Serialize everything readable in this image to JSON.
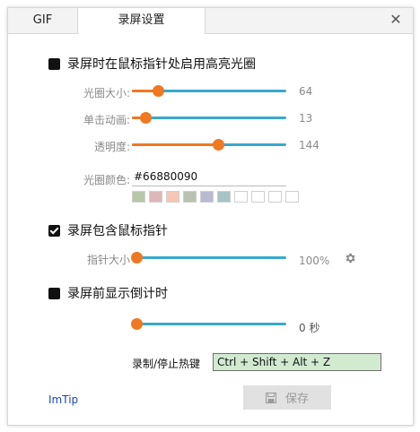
{
  "tabs": [
    {
      "label": "GIF"
    },
    {
      "label": "录屏设置"
    }
  ],
  "close_glyph": "✕",
  "halo": {
    "label": "录屏时在鼠标指针处启用高亮光圈",
    "size": {
      "label": "光圈大小:",
      "value": "64",
      "fraction": 0.17
    },
    "click_anim": {
      "label": "单击动画:",
      "value": "13",
      "fraction": 0.09
    },
    "opacity": {
      "label": "透明度:",
      "value": "144",
      "fraction": 0.56
    },
    "color": {
      "label": "光圈颜色:",
      "value": "#66880090"
    },
    "swatches": [
      "#b9c7a8",
      "#dcb8b8",
      "#f6c7b6",
      "#bac2b2",
      "#b9b9d2",
      "#a6c3c5",
      "#ffffff",
      "#ffffff",
      "#ffffff",
      "#ffffff"
    ]
  },
  "pointer": {
    "label": "录屏包含鼠标指针",
    "size": {
      "label": "指针大小",
      "value": "100%",
      "fraction": 0.0
    }
  },
  "countdown": {
    "label": "录屏前显示倒计时",
    "value": "0 秒",
    "fraction": 0.0
  },
  "hotkey": {
    "label": "录制/停止热键",
    "value": "Ctrl + Shift + Alt + Z"
  },
  "footer": {
    "brand": "ImTip",
    "save_label": "保存"
  },
  "colors": {
    "accent": "#f07820",
    "track": "#38a8cf",
    "hotkey_bg": "#d1ead0",
    "brand": "#1a46b8"
  }
}
